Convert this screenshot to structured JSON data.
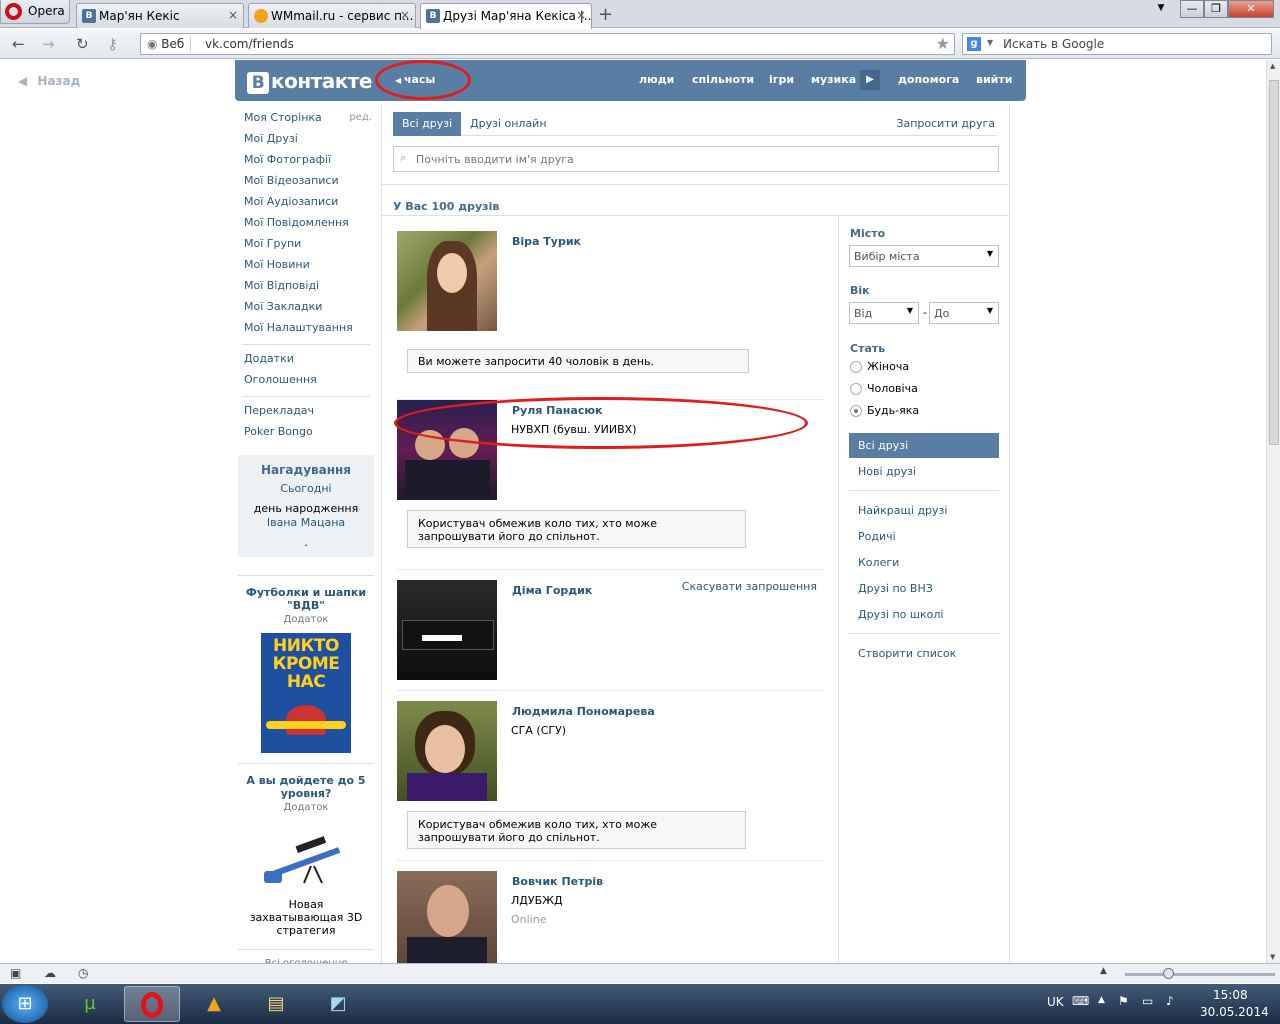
{
  "browser": {
    "opera_label": "Opera",
    "tabs": [
      {
        "icon": "В",
        "title": "Мар'ян Кекіс",
        "close": "×"
      },
      {
        "icon": "",
        "title": "WMmail.ru - сервис п...",
        "close": "×"
      },
      {
        "icon": "В",
        "title": "Друзі Мар'яна Кекіса |...",
        "close": "×"
      }
    ],
    "new_tab": "+",
    "address_prefix": "Веб",
    "url": "vk.com/friends",
    "search_placeholder": "Искать в Google",
    "window_controls": [
      "—",
      "❐",
      "✕"
    ]
  },
  "page": {
    "back_label": "Назад",
    "logo_text": "контакте",
    "logo_letter": "В",
    "header_time": "часы",
    "header_menu": [
      "люди",
      "спільноти",
      "ігри",
      "музика",
      "допомога",
      "вийти"
    ],
    "left_menu": {
      "edit_label": "ред.",
      "group1": [
        "Моя Сторінка",
        "Мої Друзі",
        "Мої Фотографії",
        "Мої Відеозаписи",
        "Мої Аудіозаписи",
        "Мої Повідомлення",
        "Мої Групи",
        "Мої Новини",
        "Мої Відповіді",
        "Мої Закладки",
        "Мої Налаштування"
      ],
      "group2": [
        "Додатки",
        "Оголошення"
      ],
      "group3": [
        "Перекладач",
        "Poker Bongo"
      ]
    },
    "reminder": {
      "title": "Нагадування",
      "today": "Сьогодні",
      "text1": " день народження ",
      "name": "Івана Мацана",
      "end": "."
    },
    "ads": [
      {
        "title": "Футболки и шапки \"ВДВ\"",
        "sub": "Додаток",
        "image_text": "НИКТО КРОМЕ НАС"
      },
      {
        "title": "А вы дойдете до 5 уровня?",
        "sub": "Додаток",
        "caption": "Новая захватывающая 3D стратегия"
      }
    ],
    "all_ads": "Всі оголошення",
    "tabs": {
      "all": "Всі друзі",
      "online": "Друзі онлайн",
      "invite": "Запросити друга"
    },
    "search_placeholder": "Почніть вводити ім'я друга",
    "count_text": "У Вас 100 друзів",
    "friends": [
      {
        "name": "Віра Турик",
        "uni": "",
        "online": "",
        "notice": "Ви можете запросити 40 чоловік в день."
      },
      {
        "name": "Руля Панасюк",
        "uni": "НУВХП (бувш. УИИВХ)",
        "online": "",
        "notice": "Користувач обмежив коло тих, хто може запрошувати його до спільнот."
      },
      {
        "name": "Діма Гордик",
        "uni": "",
        "online": "",
        "cancel": "Скасувати запрошення"
      },
      {
        "name": "Людмила Пономарева",
        "uni": "СГА (СГУ)",
        "online": "",
        "notice": "Користувач обмежив коло тих, хто може запрошувати його до спільнот."
      },
      {
        "name": "Вовчик Петрів",
        "uni": "ЛДУБЖД",
        "online": "Online"
      }
    ],
    "filters": {
      "city_label": "Місто",
      "city_value": "Вибір міста",
      "age_label": "Вік",
      "age_from": "Від",
      "age_dash": "-",
      "age_to": "До",
      "sex_label": "Стать",
      "sex_options": [
        "Жіноча",
        "Чоловіча",
        "Будь-яка"
      ],
      "lists": [
        "Всі друзі",
        "Нові друзі",
        "Найкращі друзі",
        "Родичі",
        "Колеги",
        "Друзі по ВНЗ",
        "Друзі по школі",
        "Створити список"
      ]
    }
  },
  "taskbar": {
    "lang": "UK",
    "time": "15:08",
    "date": "30.05.2014"
  },
  "colors": {
    "vk_blue": "#597da3",
    "link": "#2b587a",
    "annotation": "#e21b1b"
  }
}
